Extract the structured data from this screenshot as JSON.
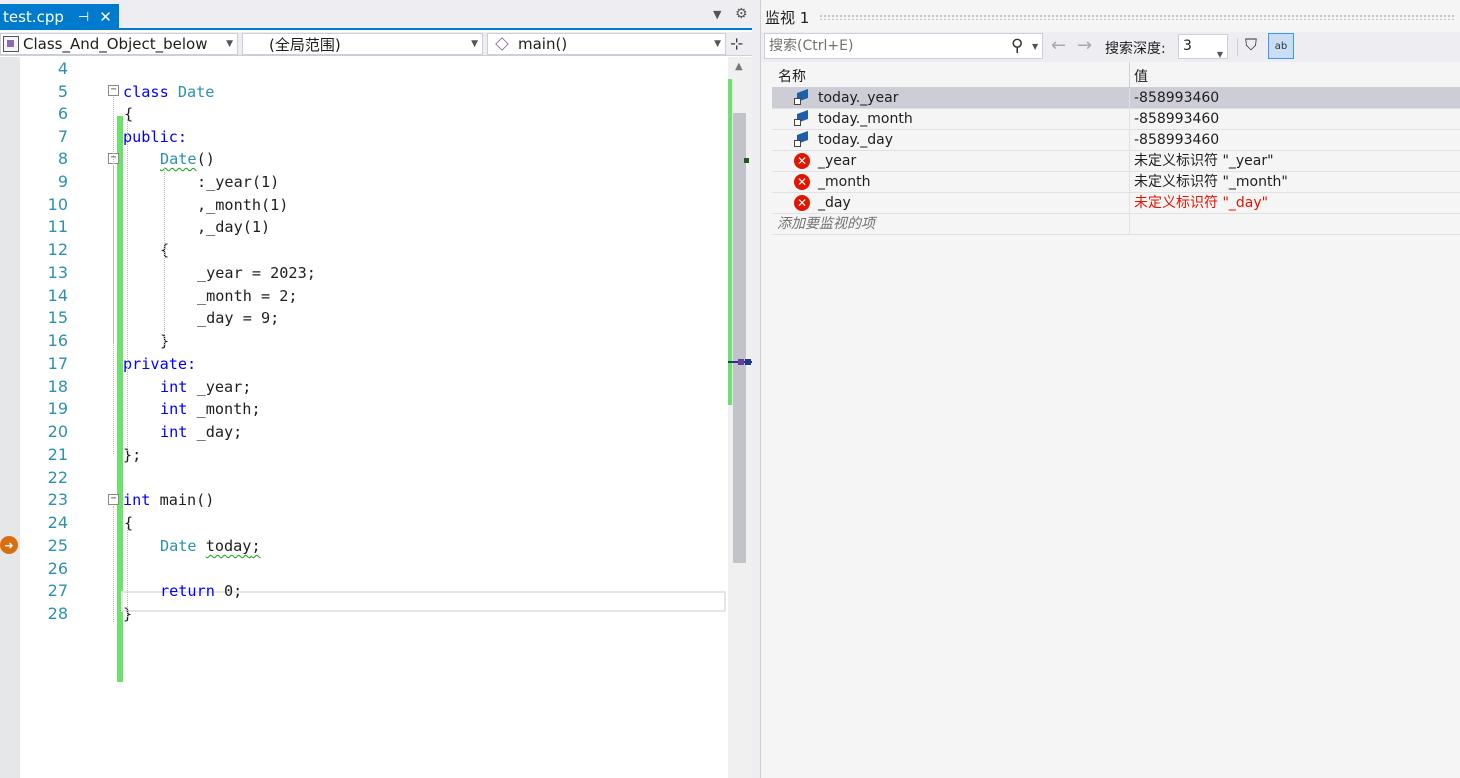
{
  "editor": {
    "tab": {
      "label": "test.cpp",
      "pin": "⊣",
      "close": "✕"
    },
    "navbar": {
      "class_combo": "Class_And_Object_below",
      "scope_combo": "(全局范围)",
      "function_combo": "main()"
    },
    "lines": [
      {
        "num": "4"
      },
      {
        "num": "5"
      },
      {
        "num": "6"
      },
      {
        "num": "7"
      },
      {
        "num": "8"
      },
      {
        "num": "9"
      },
      {
        "num": "10"
      },
      {
        "num": "11"
      },
      {
        "num": "12"
      },
      {
        "num": "13"
      },
      {
        "num": "14"
      },
      {
        "num": "15"
      },
      {
        "num": "16"
      },
      {
        "num": "17"
      },
      {
        "num": "18"
      },
      {
        "num": "19"
      },
      {
        "num": "20"
      },
      {
        "num": "21"
      },
      {
        "num": "22"
      },
      {
        "num": "23"
      },
      {
        "num": "24"
      },
      {
        "num": "25"
      },
      {
        "num": "26"
      },
      {
        "num": "27"
      },
      {
        "num": "28"
      }
    ],
    "code": {
      "l5_kw": "class",
      "l5_type": "Date",
      "l6": "{",
      "l7": "public:",
      "l8_type": "Date",
      "l8_rest": "()",
      "l9": ":_year(1)",
      "l10": ",_month(1)",
      "l11": ",_day(1)",
      "l12": "{",
      "l13": "_year = 2023;",
      "l14": "_month = 2;",
      "l15": "_day = 9;",
      "l16": "}",
      "l17": "private:",
      "l18_kw": "int",
      "l18_rest": " _year;",
      "l19_kw": "int",
      "l19_rest": " _month;",
      "l20_kw": "int",
      "l20_rest": " _day;",
      "l21": "};",
      "l23_kw": "int",
      "l23_rest": " main()",
      "l24": "{",
      "l25_type": "Date",
      "l25_var": "today",
      "l25_end": ";",
      "l27_kw": "return",
      "l27_rest": " 0;",
      "l28": "}"
    }
  },
  "watch": {
    "title": "监视 1",
    "search_placeholder": "搜索(Ctrl+E)",
    "depth_label": "搜索深度:",
    "depth_value": "3",
    "columns": {
      "name": "名称",
      "value": "值"
    },
    "rows": [
      {
        "name": "today._year",
        "value": "-858993460",
        "icon": "member-icon",
        "selected": true,
        "error": false
      },
      {
        "name": "today._month",
        "value": "-858993460",
        "icon": "member-icon",
        "selected": false,
        "error": false
      },
      {
        "name": "today._day",
        "value": "-858993460",
        "icon": "member-icon",
        "selected": false,
        "error": false
      },
      {
        "name": "_year",
        "value": "未定义标识符 \"_year\"",
        "icon": "error-icon",
        "selected": false,
        "error": true
      },
      {
        "name": "_month",
        "value": "未定义标识符 \"_month\"",
        "icon": "error-icon",
        "selected": false,
        "error": true
      },
      {
        "name": "_day",
        "value": "未定义标识符 \"_day\"",
        "icon": "error-icon",
        "selected": false,
        "error": true,
        "highlight": true
      }
    ],
    "add_item_placeholder": "添加要监视的项"
  },
  "colors": {
    "accent": "#007acc",
    "keyword": "#0000ff",
    "type": "#2b91af",
    "error": "#e51400",
    "change_bar": "#6ce26c"
  }
}
